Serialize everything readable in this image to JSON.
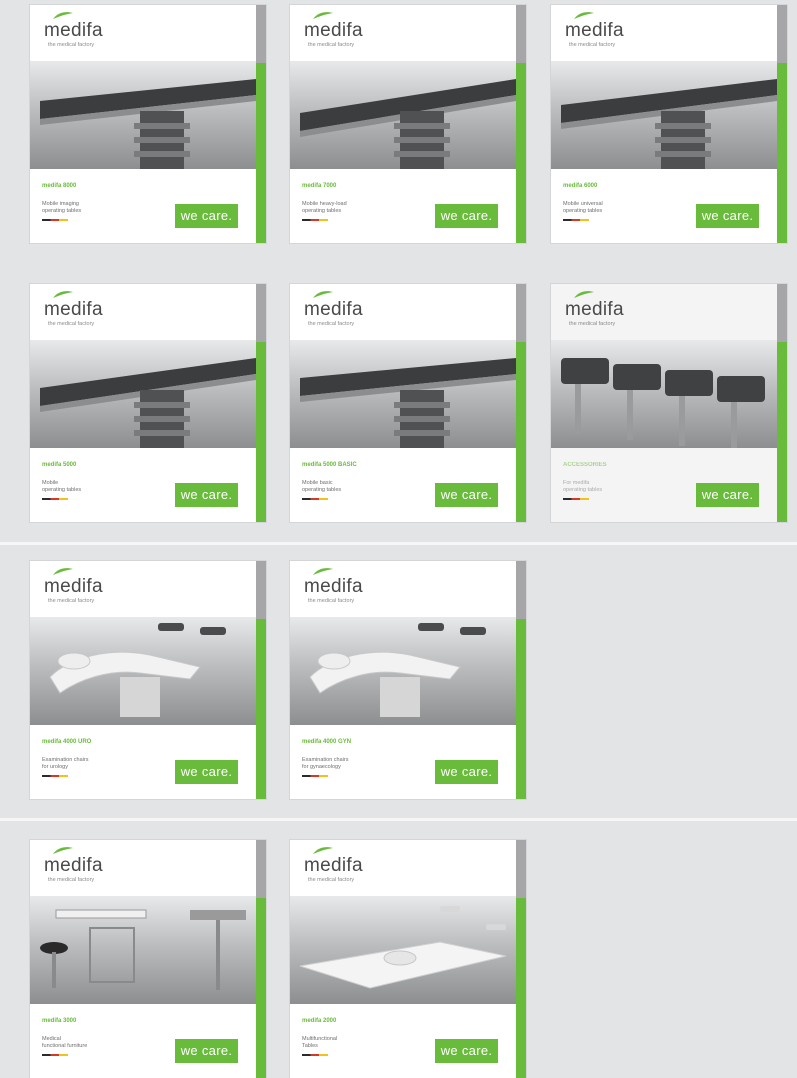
{
  "brand": {
    "logo": "medifa",
    "tagline": "the medical factory",
    "slogan": "we care.",
    "colors": {
      "green": "#69bb3b",
      "gray_bar": "#a6a6a8"
    }
  },
  "cards": [
    {
      "model": "medifa 8000",
      "desc": "Mobile imaging\noperating tables",
      "image": "operating-table-icon"
    },
    {
      "model": "medifa 7000",
      "desc": "Mobile heavy-load\noperating tables",
      "image": "operating-table-icon"
    },
    {
      "model": "medifa 6000",
      "desc": "Mobile universal\noperating tables",
      "image": "operating-table-icon"
    },
    {
      "model": "medifa 5000",
      "desc": "Mobile\noperating tables",
      "image": "operating-table-icon"
    },
    {
      "model": "medifa 5000 BASIC",
      "desc": "Mobile basic\noperating tables",
      "image": "operating-table-icon"
    },
    {
      "model": "ACCESSORIES",
      "desc": "For medifa\noperating tables",
      "image": "accessories-icon"
    },
    {
      "model": "medifa 4000 URO",
      "desc": "Examination chairs\nfor urology",
      "image": "examination-chair-icon"
    },
    {
      "model": "medifa 4000 GYN",
      "desc": "Examination chairs\nfor gynaecology",
      "image": "examination-chair-icon"
    },
    {
      "model": "medifa 3000",
      "desc": "Medical\nfunctional furniture",
      "image": "furniture-icon"
    },
    {
      "model": "medifa 2000",
      "desc": "Multifunctional\nTables",
      "image": "multifunctional-table-icon"
    }
  ]
}
